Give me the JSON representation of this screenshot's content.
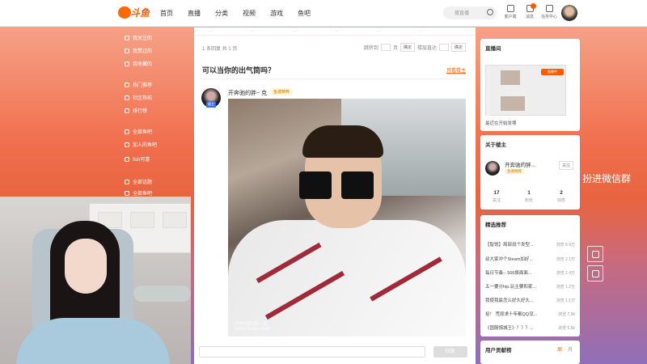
{
  "topbar": {
    "logo_text": "斗鱼",
    "nav": [
      "首页",
      "直播",
      "分类",
      "视频",
      "游戏",
      "鱼吧"
    ],
    "search_placeholder": "搜直播",
    "icons": [
      {
        "icon": "fish-icon",
        "label": "客户端"
      },
      {
        "icon": "history-icon",
        "label": "消息"
      },
      {
        "icon": "task-icon",
        "label": "任务中心"
      }
    ]
  },
  "left_nav": {
    "items": [
      "我关注的",
      "我赞过的",
      "我收藏的",
      "热门推荐",
      "社区热帖",
      "排行榜",
      "全部鱼吧",
      "加入的鱼吧",
      "fish可喜",
      "全部话题",
      "全部鱼吧"
    ]
  },
  "post": {
    "strip_items": [
      "...",
      "...",
      "...",
      "...",
      "...",
      "..."
    ],
    "pager_left": "1 条回复 共 1 页",
    "pager_jump": "跳转到",
    "pager_page": "页",
    "pager_ok": "确定",
    "pager_floor": "楼层直达",
    "pager_ok2": "确定",
    "title": "可以当你的出气筒吗？",
    "only_host": "只看楼主",
    "author": "开奔驰的胖~ 克",
    "author_tag": "楼主",
    "fish_badge": "鱼塘精粹",
    "watermark": "开奔驰的胖~ 克\nyuba.douyu.com",
    "reply_button": "回复"
  },
  "sidebar": {
    "live_title": "直播间",
    "live_tag": "直播中",
    "live_caption": "最近在开始发哪",
    "host_title": "关于楼主",
    "host_name": "开奔驰的胖...",
    "host_badge": "鱼塘精粹",
    "follow_label": "关注",
    "stats": [
      {
        "value": "17",
        "label": "关注"
      },
      {
        "value": "1",
        "label": "粉丝"
      },
      {
        "value": "2",
        "label": "动态"
      }
    ],
    "rec_title": "精选推荐",
    "recommendations": [
      {
        "title": "【智饱】局部战个发型...",
        "views": "浏览 8.9万"
      },
      {
        "title": "幼大家冲个Steam加好...",
        "views": "浏览 2.1万"
      },
      {
        "title": "每日节奏-- 566换面面...",
        "views": "浏览 1.4万"
      },
      {
        "title": "五一要分hip.玩主要和家...",
        "views": "浏览 1.2万"
      },
      {
        "title": "我使我最怎么好久好久...",
        "views": "浏览 1.1万"
      },
      {
        "title": "拾！ 荒原求十年都QQ没...",
        "views": "浏览 7.9k"
      },
      {
        "title": "《国服憾城王》？？？...",
        "views": "浏览 5.8k"
      }
    ],
    "rank_title": "用户贡献榜",
    "rank_tabs": [
      "周",
      "月"
    ]
  },
  "overlay_text": "扮进微信群"
}
